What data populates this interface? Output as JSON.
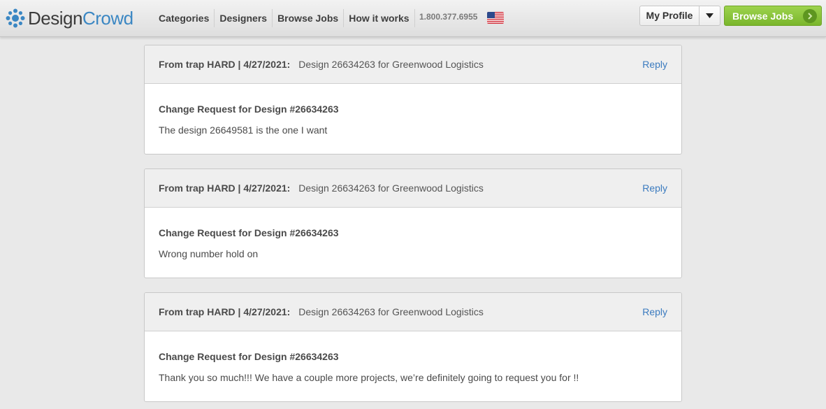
{
  "header": {
    "logo_part1": "Design",
    "logo_part2": "Crowd",
    "nav": [
      "Categories",
      "Designers",
      "Browse Jobs",
      "How it works"
    ],
    "phone": "1.800.377.6955",
    "my_profile": "My Profile",
    "browse_jobs_button": "Browse Jobs",
    "colors": {
      "logo_blue": "#3b87c3",
      "browse_green": "#8cc63f",
      "link": "#3b7bbf"
    }
  },
  "messages": [
    {
      "from": "From trap HARD  |  4/27/2021:",
      "subject": "Design 26634263 for Greenwood Logistics",
      "reply": "Reply",
      "title": "Change Request for Design #26634263",
      "body": "The design 26649581 is the one I want"
    },
    {
      "from": "From trap HARD  |  4/27/2021:",
      "subject": "Design 26634263 for Greenwood Logistics",
      "reply": "Reply",
      "title": "Change Request for Design #26634263",
      "body": "Wrong number hold on"
    },
    {
      "from": "From trap HARD  |  4/27/2021:",
      "subject": "Design 26634263 for Greenwood Logistics",
      "reply": "Reply",
      "title": "Change Request for Design #26634263",
      "body": "Thank you so much!!! We have a couple more projects, we’re definitely going to request you for !!"
    }
  ]
}
